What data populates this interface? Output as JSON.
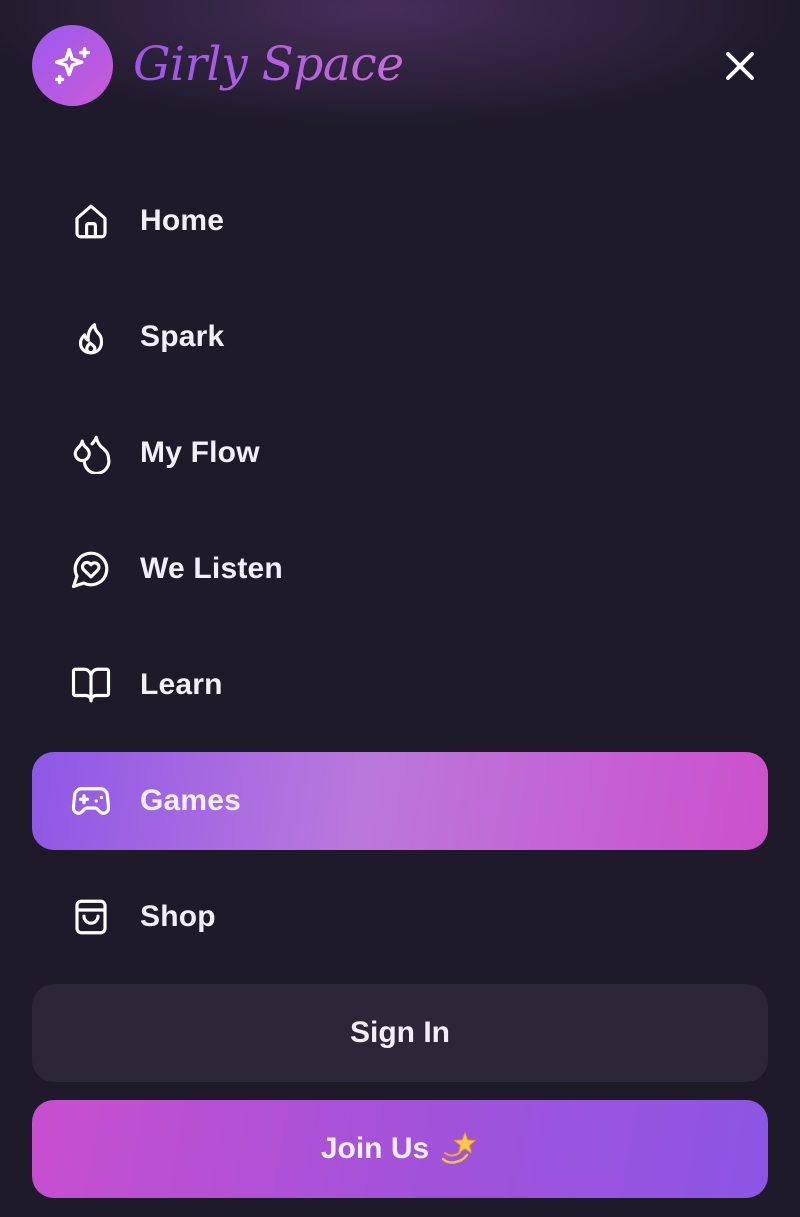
{
  "header": {
    "brand_name": "Girly Space",
    "logo_icon": "sparkles-icon",
    "close_icon": "close-icon"
  },
  "nav": {
    "items": [
      {
        "label": "Home",
        "icon": "home-icon",
        "active": false
      },
      {
        "label": "Spark",
        "icon": "flame-icon",
        "active": false
      },
      {
        "label": "My Flow",
        "icon": "droplets-icon",
        "active": false
      },
      {
        "label": "We Listen",
        "icon": "heart-chat-icon",
        "active": false
      },
      {
        "label": "Learn",
        "icon": "book-icon",
        "active": false
      },
      {
        "label": "Games",
        "icon": "gamepad-icon",
        "active": true
      },
      {
        "label": "Shop",
        "icon": "shopping-bag-icon",
        "active": false
      }
    ]
  },
  "actions": {
    "sign_in_label": "Sign In",
    "join_label": "Join Us",
    "join_emoji_icon": "dizzy-star-icon"
  },
  "colors": {
    "background": "#1e1a29",
    "accent_purple": "#8e58e6",
    "accent_pink": "#cc50cc",
    "sign_in_bg": "#2c2638",
    "text": "#f3effa"
  }
}
